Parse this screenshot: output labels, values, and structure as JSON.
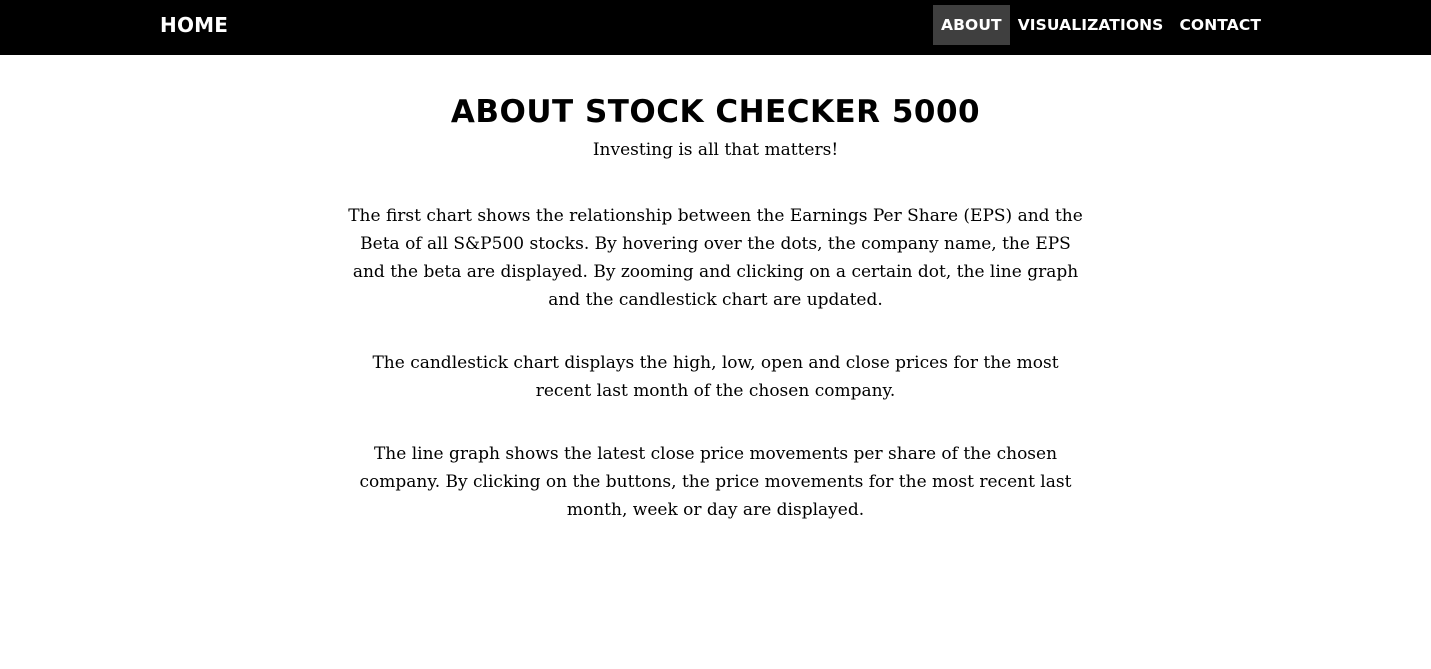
{
  "navbar": {
    "brand": "HOME",
    "links": [
      {
        "label": "ABOUT",
        "active": true
      },
      {
        "label": "VISUALIZATIONS",
        "active": false
      },
      {
        "label": "CONTACT",
        "active": false
      }
    ],
    "colors": {
      "background": "#000000",
      "active_background": "#3f3f3f",
      "text": "#ffffff"
    }
  },
  "main": {
    "title": "ABOUT STOCK CHECKER 5000",
    "tagline": "Investing is all that matters!",
    "paragraphs": [
      "The first chart shows the relationship between the Earnings Per Share (EPS) and the Beta of all S&P500 stocks. By hovering over the dots, the company name, the EPS and the beta are displayed. By zooming and clicking on a certain dot, the line graph and the candlestick chart are updated.",
      "The candlestick chart displays the high, low, open and close prices for the most recent last month of the chosen company.",
      "The line graph shows the latest close price movements per share of the chosen company. By clicking on the buttons, the price movements for the most recent last month, week or day are displayed."
    ]
  }
}
